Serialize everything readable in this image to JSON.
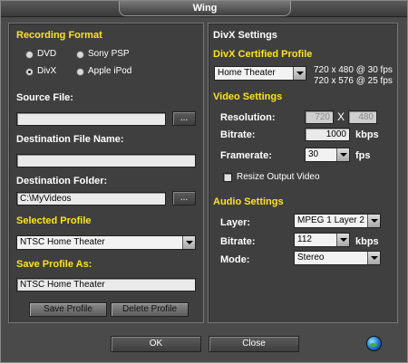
{
  "window": {
    "title": "Wing"
  },
  "left": {
    "recording_format_label": "Recording Format",
    "formats": [
      {
        "label": "DVD",
        "selected": false
      },
      {
        "label": "Sony PSP",
        "selected": false
      },
      {
        "label": "DivX",
        "selected": true
      },
      {
        "label": "Apple iPod",
        "selected": false
      }
    ],
    "source_file_label": "Source File:",
    "source_file_value": "",
    "browse_label": "...",
    "destination_name_label": "Destination File Name:",
    "destination_name_value": "",
    "destination_folder_label": "Destination Folder:",
    "destination_folder_value": "C:\\MyVideos",
    "selected_profile_label": "Selected Profile",
    "selected_profile_value": "NTSC Home Theater",
    "save_profile_as_label": "Save Profile As:",
    "save_profile_as_value": "NTSC Home Theater",
    "save_profile_button": "Save Profile",
    "delete_profile_button": "Delete Profile"
  },
  "right": {
    "title": "DivX Settings",
    "certified_profile_label": "DivX Certified Profile",
    "certified_profile_value": "Home Theater",
    "profile_info_line1": "720 x 480 @ 30 fps",
    "profile_info_line2": "720 x 576 @ 25 fps",
    "video_settings_label": "Video Settings",
    "resolution_label": "Resolution:",
    "resolution_width": "720",
    "resolution_x": "X",
    "resolution_height": "480",
    "bitrate_label": "Bitrate:",
    "bitrate_value": "1000",
    "bitrate_unit": "kbps",
    "framerate_label": "Framerate:",
    "framerate_value": "30",
    "framerate_unit": "fps",
    "resize_label": "Resize Output Video",
    "audio_settings_label": "Audio Settings",
    "layer_label": "Layer:",
    "layer_value": "MPEG 1 Layer 2",
    "audio_bitrate_label": "Bitrate:",
    "audio_bitrate_value": "112",
    "audio_bitrate_unit": "kbps",
    "mode_label": "Mode:",
    "mode_value": "Stereo"
  },
  "footer": {
    "ok_label": "OK",
    "close_label": "Close"
  },
  "colors": {
    "accent": "#ffe21f",
    "panel": "#3f3f3f",
    "window": "#4a4a4a"
  }
}
